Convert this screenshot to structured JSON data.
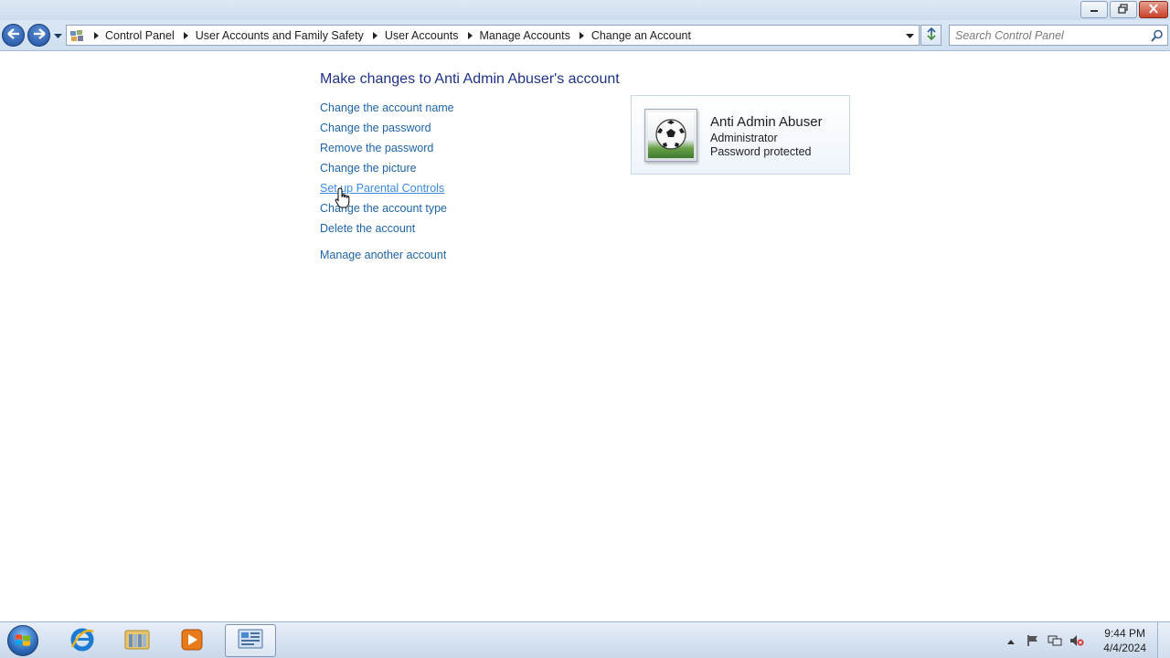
{
  "window": {
    "caption_buttons": [
      "minimize-icon",
      "restore-icon",
      "close-icon"
    ]
  },
  "address": {
    "root_icon": "control-panel-icon",
    "breadcrumbs": [
      {
        "label": "Control Panel"
      },
      {
        "label": "User Accounts and Family Safety"
      },
      {
        "label": "User Accounts"
      },
      {
        "label": "Manage Accounts"
      },
      {
        "label": "Change an Account"
      }
    ]
  },
  "search": {
    "placeholder": "Search Control Panel"
  },
  "main": {
    "heading": "Make changes to Anti Admin Abuser's account",
    "tasks": [
      {
        "label": "Change the account name"
      },
      {
        "label": "Change the password"
      },
      {
        "label": "Remove the password"
      },
      {
        "label": "Change the picture"
      },
      {
        "label": "Set up Parental Controls"
      },
      {
        "label": "Change the account type"
      },
      {
        "label": "Delete the account"
      }
    ],
    "manage_another": "Manage another account"
  },
  "account": {
    "name": "Anti Admin Abuser",
    "type": "Administrator",
    "status": "Password protected",
    "picture": "soccer-ball-icon"
  },
  "taskbar": {
    "apps": [
      "internet-explorer-icon",
      "windows-explorer-icon",
      "media-player-icon",
      "control-panel-icon"
    ],
    "clock": {
      "time": "9:44 PM",
      "date": "4/4/2024"
    }
  }
}
